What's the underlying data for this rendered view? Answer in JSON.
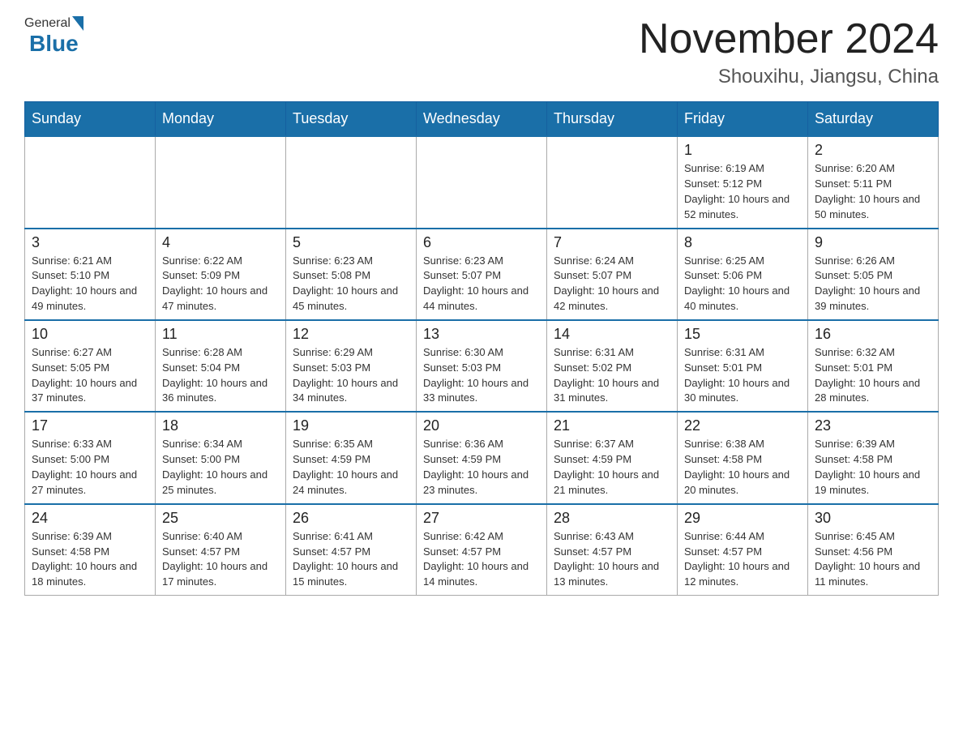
{
  "header": {
    "month_title": "November 2024",
    "location": "Shouxihu, Jiangsu, China",
    "logo_general": "General",
    "logo_blue": "Blue"
  },
  "days_of_week": [
    "Sunday",
    "Monday",
    "Tuesday",
    "Wednesday",
    "Thursday",
    "Friday",
    "Saturday"
  ],
  "weeks": [
    [
      {
        "day": "",
        "info": ""
      },
      {
        "day": "",
        "info": ""
      },
      {
        "day": "",
        "info": ""
      },
      {
        "day": "",
        "info": ""
      },
      {
        "day": "",
        "info": ""
      },
      {
        "day": "1",
        "info": "Sunrise: 6:19 AM\nSunset: 5:12 PM\nDaylight: 10 hours and 52 minutes."
      },
      {
        "day": "2",
        "info": "Sunrise: 6:20 AM\nSunset: 5:11 PM\nDaylight: 10 hours and 50 minutes."
      }
    ],
    [
      {
        "day": "3",
        "info": "Sunrise: 6:21 AM\nSunset: 5:10 PM\nDaylight: 10 hours and 49 minutes."
      },
      {
        "day": "4",
        "info": "Sunrise: 6:22 AM\nSunset: 5:09 PM\nDaylight: 10 hours and 47 minutes."
      },
      {
        "day": "5",
        "info": "Sunrise: 6:23 AM\nSunset: 5:08 PM\nDaylight: 10 hours and 45 minutes."
      },
      {
        "day": "6",
        "info": "Sunrise: 6:23 AM\nSunset: 5:07 PM\nDaylight: 10 hours and 44 minutes."
      },
      {
        "day": "7",
        "info": "Sunrise: 6:24 AM\nSunset: 5:07 PM\nDaylight: 10 hours and 42 minutes."
      },
      {
        "day": "8",
        "info": "Sunrise: 6:25 AM\nSunset: 5:06 PM\nDaylight: 10 hours and 40 minutes."
      },
      {
        "day": "9",
        "info": "Sunrise: 6:26 AM\nSunset: 5:05 PM\nDaylight: 10 hours and 39 minutes."
      }
    ],
    [
      {
        "day": "10",
        "info": "Sunrise: 6:27 AM\nSunset: 5:05 PM\nDaylight: 10 hours and 37 minutes."
      },
      {
        "day": "11",
        "info": "Sunrise: 6:28 AM\nSunset: 5:04 PM\nDaylight: 10 hours and 36 minutes."
      },
      {
        "day": "12",
        "info": "Sunrise: 6:29 AM\nSunset: 5:03 PM\nDaylight: 10 hours and 34 minutes."
      },
      {
        "day": "13",
        "info": "Sunrise: 6:30 AM\nSunset: 5:03 PM\nDaylight: 10 hours and 33 minutes."
      },
      {
        "day": "14",
        "info": "Sunrise: 6:31 AM\nSunset: 5:02 PM\nDaylight: 10 hours and 31 minutes."
      },
      {
        "day": "15",
        "info": "Sunrise: 6:31 AM\nSunset: 5:01 PM\nDaylight: 10 hours and 30 minutes."
      },
      {
        "day": "16",
        "info": "Sunrise: 6:32 AM\nSunset: 5:01 PM\nDaylight: 10 hours and 28 minutes."
      }
    ],
    [
      {
        "day": "17",
        "info": "Sunrise: 6:33 AM\nSunset: 5:00 PM\nDaylight: 10 hours and 27 minutes."
      },
      {
        "day": "18",
        "info": "Sunrise: 6:34 AM\nSunset: 5:00 PM\nDaylight: 10 hours and 25 minutes."
      },
      {
        "day": "19",
        "info": "Sunrise: 6:35 AM\nSunset: 4:59 PM\nDaylight: 10 hours and 24 minutes."
      },
      {
        "day": "20",
        "info": "Sunrise: 6:36 AM\nSunset: 4:59 PM\nDaylight: 10 hours and 23 minutes."
      },
      {
        "day": "21",
        "info": "Sunrise: 6:37 AM\nSunset: 4:59 PM\nDaylight: 10 hours and 21 minutes."
      },
      {
        "day": "22",
        "info": "Sunrise: 6:38 AM\nSunset: 4:58 PM\nDaylight: 10 hours and 20 minutes."
      },
      {
        "day": "23",
        "info": "Sunrise: 6:39 AM\nSunset: 4:58 PM\nDaylight: 10 hours and 19 minutes."
      }
    ],
    [
      {
        "day": "24",
        "info": "Sunrise: 6:39 AM\nSunset: 4:58 PM\nDaylight: 10 hours and 18 minutes."
      },
      {
        "day": "25",
        "info": "Sunrise: 6:40 AM\nSunset: 4:57 PM\nDaylight: 10 hours and 17 minutes."
      },
      {
        "day": "26",
        "info": "Sunrise: 6:41 AM\nSunset: 4:57 PM\nDaylight: 10 hours and 15 minutes."
      },
      {
        "day": "27",
        "info": "Sunrise: 6:42 AM\nSunset: 4:57 PM\nDaylight: 10 hours and 14 minutes."
      },
      {
        "day": "28",
        "info": "Sunrise: 6:43 AM\nSunset: 4:57 PM\nDaylight: 10 hours and 13 minutes."
      },
      {
        "day": "29",
        "info": "Sunrise: 6:44 AM\nSunset: 4:57 PM\nDaylight: 10 hours and 12 minutes."
      },
      {
        "day": "30",
        "info": "Sunrise: 6:45 AM\nSunset: 4:56 PM\nDaylight: 10 hours and 11 minutes."
      }
    ]
  ]
}
